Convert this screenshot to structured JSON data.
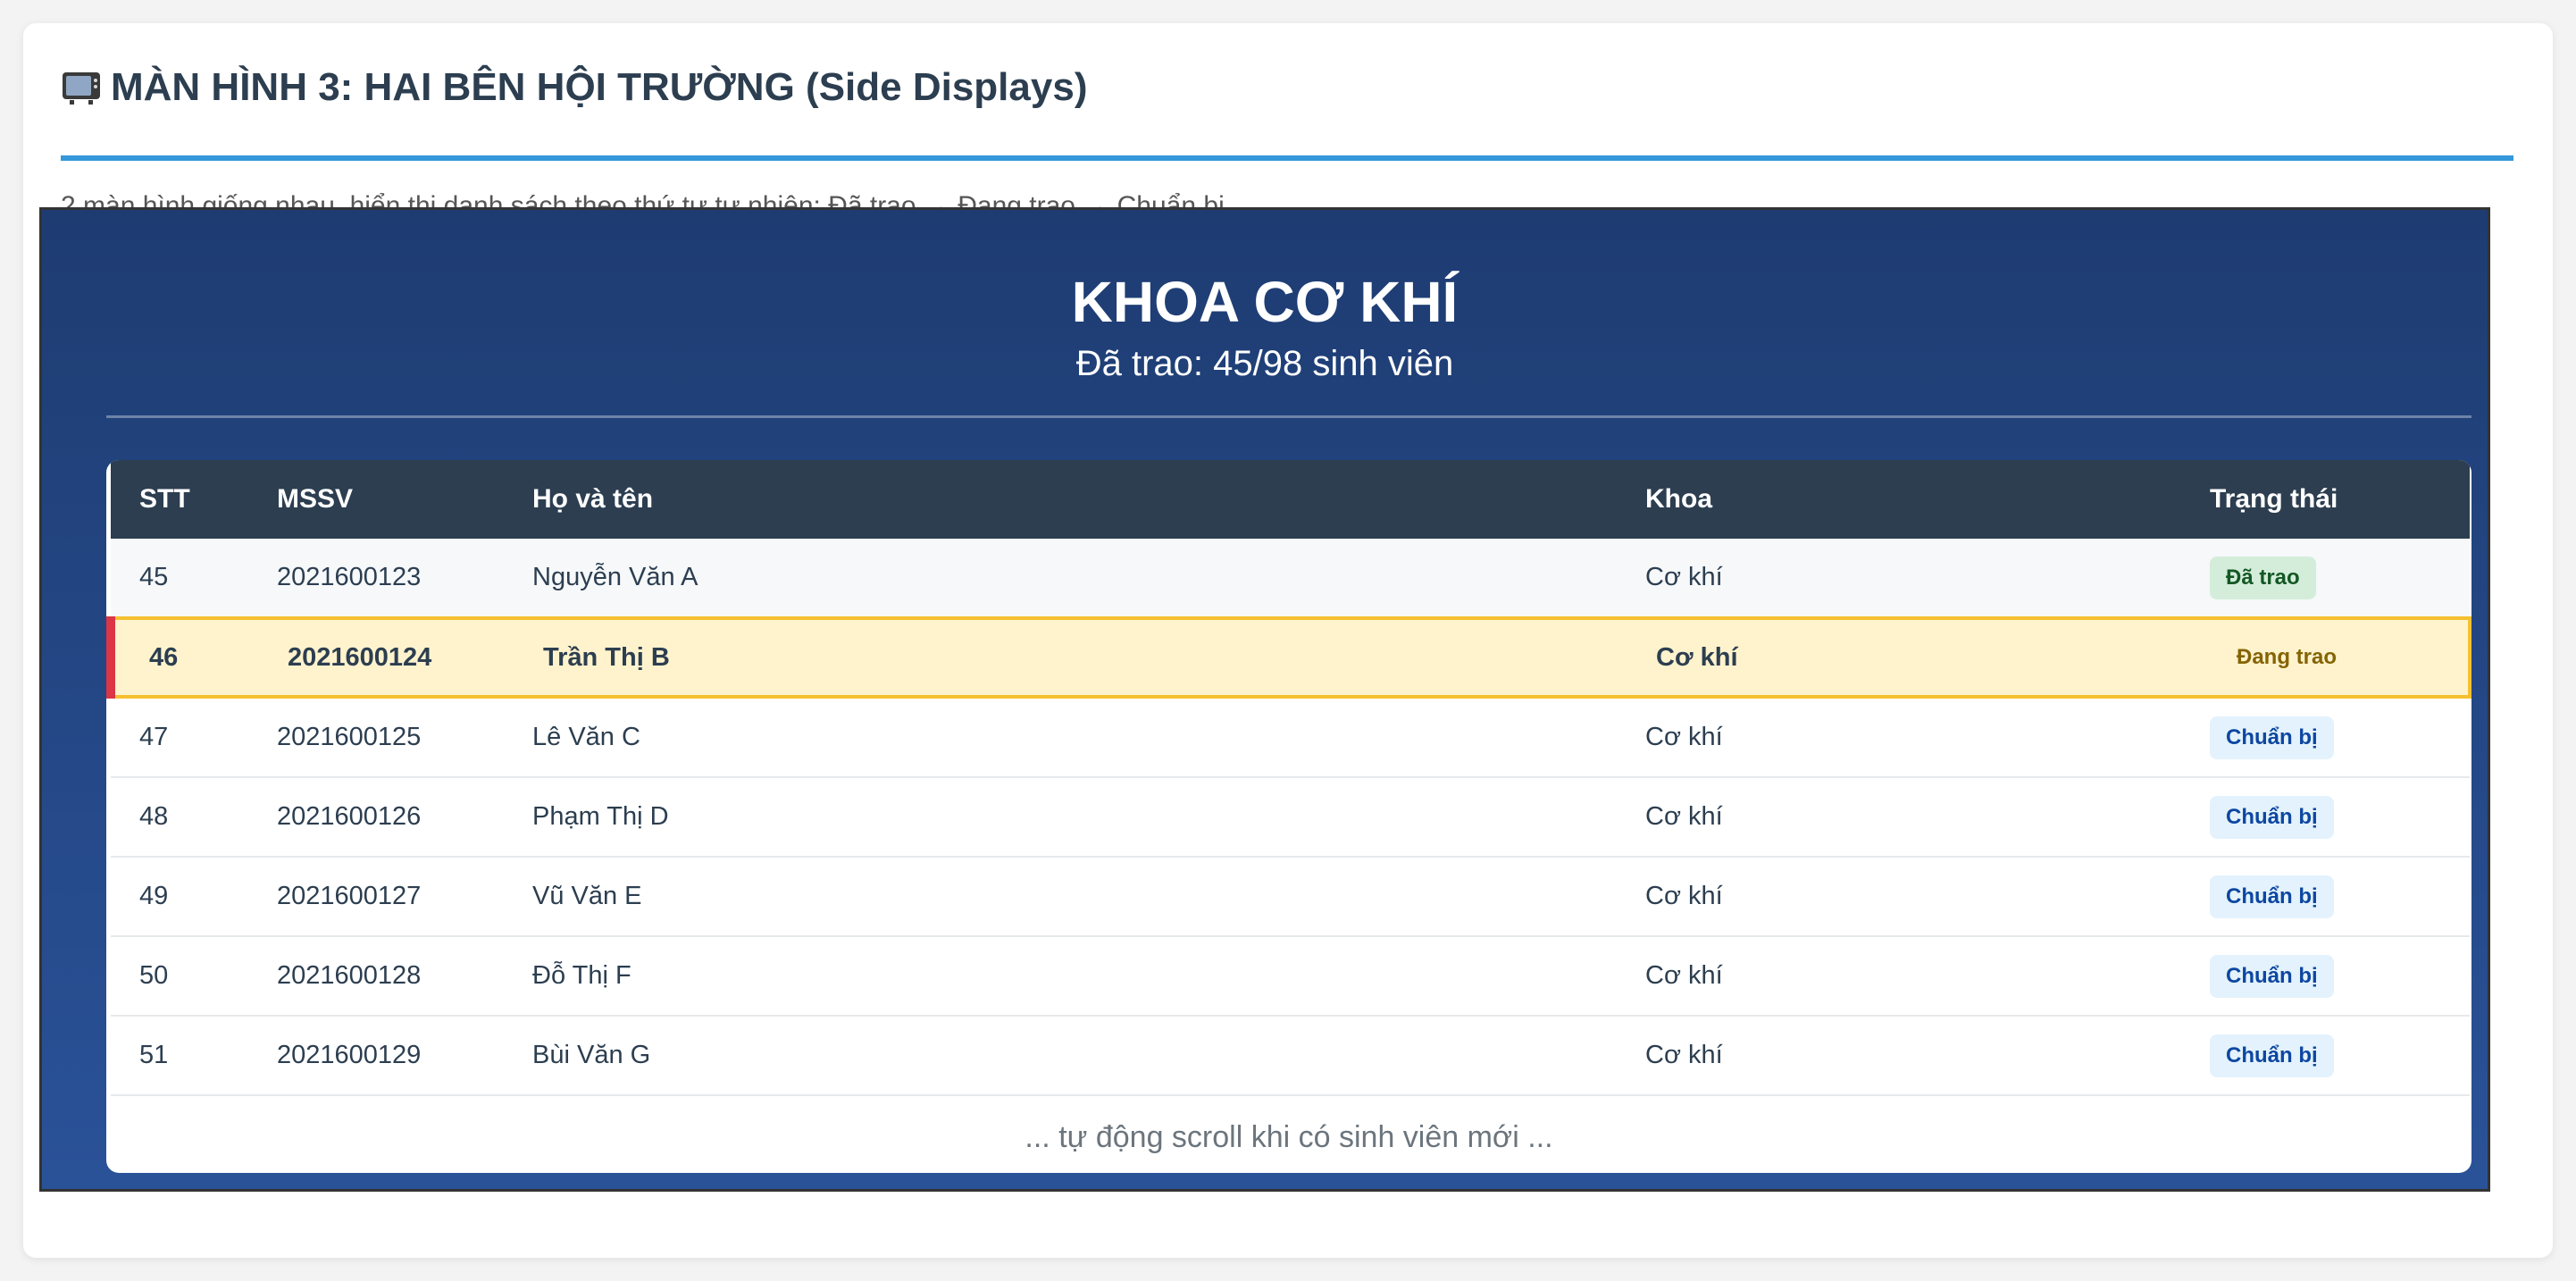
{
  "section": {
    "icon": "tv-icon",
    "title": "MÀN HÌNH 3: HAI BÊN HỘI TRƯỜNG (Side Displays)",
    "description": "2 màn hình giống nhau, hiển thị danh sách theo thứ tự tự nhiên: Đã trao → Đang trao → Chuẩn bị"
  },
  "display": {
    "department": "KHOA CƠ KHÍ",
    "progress": "Đã trao: 45/98 sinh viên",
    "table": {
      "headers": [
        "STT",
        "MSSV",
        "Họ và tên",
        "Khoa",
        "Trạng thái"
      ],
      "rows": [
        {
          "stt": "45",
          "mssv": "2021600123",
          "name": "Nguyễn Văn A",
          "khoa": "Cơ khí",
          "status": "Đã trao",
          "state": "done"
        },
        {
          "stt": "46",
          "mssv": "2021600124",
          "name": "Trần Thị B",
          "khoa": "Cơ khí",
          "status": "Đang trao",
          "state": "active"
        },
        {
          "stt": "47",
          "mssv": "2021600125",
          "name": "Lê Văn C",
          "khoa": "Cơ khí",
          "status": "Chuẩn bị",
          "state": "prep"
        },
        {
          "stt": "48",
          "mssv": "2021600126",
          "name": "Phạm Thị D",
          "khoa": "Cơ khí",
          "status": "Chuẩn bị",
          "state": "prep"
        },
        {
          "stt": "49",
          "mssv": "2021600127",
          "name": "Vũ Văn E",
          "khoa": "Cơ khí",
          "status": "Chuẩn bị",
          "state": "prep"
        },
        {
          "stt": "50",
          "mssv": "2021600128",
          "name": "Đỗ Thị F",
          "khoa": "Cơ khí",
          "status": "Chuẩn bị",
          "state": "prep"
        },
        {
          "stt": "51",
          "mssv": "2021600129",
          "name": "Bùi Văn G",
          "khoa": "Cơ khí",
          "status": "Chuẩn bị",
          "state": "prep"
        }
      ],
      "footer_note": "... tự động scroll khi có sinh viên mới ..."
    }
  },
  "colors": {
    "accent": "#3498db",
    "screen_gradient_top": "#1e3c72",
    "screen_gradient_bottom": "#2a5298",
    "header_row": "#2c3e50",
    "active_row": "#fff3cd",
    "active_border": "#f5c030",
    "active_marker": "#dc3545"
  }
}
